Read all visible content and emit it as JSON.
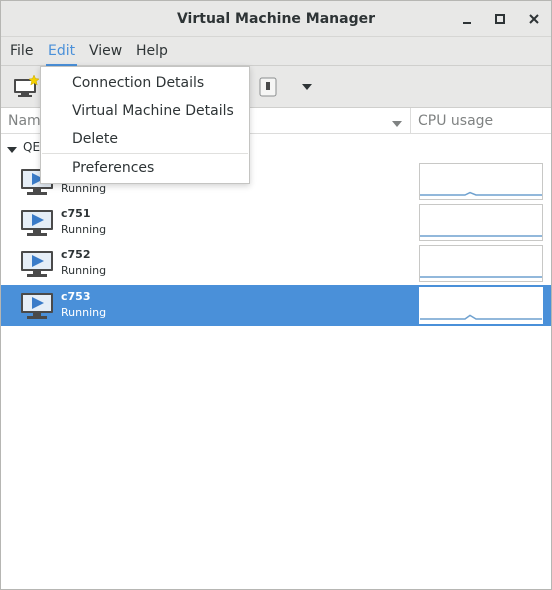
{
  "window": {
    "title": "Virtual Machine Manager"
  },
  "menubar": {
    "items": [
      {
        "label": "File"
      },
      {
        "label": "Edit"
      },
      {
        "label": "View"
      },
      {
        "label": "Help"
      }
    ]
  },
  "edit_menu": {
    "items": [
      {
        "label": "Connection Details"
      },
      {
        "label": "Virtual Machine Details"
      },
      {
        "label": "Delete"
      },
      {
        "label": "Preferences"
      }
    ]
  },
  "columns": {
    "name": "Nam",
    "cpu": "CPU usage"
  },
  "group": {
    "label": "QE"
  },
  "vms": [
    {
      "name": "",
      "status": "Running",
      "cpu_peak": 0.12,
      "selected": false
    },
    {
      "name": "c751",
      "status": "Running",
      "cpu_peak": 0.0,
      "selected": false
    },
    {
      "name": "c752",
      "status": "Running",
      "cpu_peak": 0.0,
      "selected": false
    },
    {
      "name": "c753",
      "status": "Running",
      "cpu_peak": 0.18,
      "selected": true
    }
  ],
  "icons": {
    "minimize": "minimize-icon",
    "maximize": "maximize-icon",
    "close": "close-icon",
    "new_vm": "new-vm-icon",
    "vm": "vm-monitor-icon"
  },
  "colors": {
    "accent": "#4a90d9",
    "graph_line": "#6fa1cf"
  }
}
